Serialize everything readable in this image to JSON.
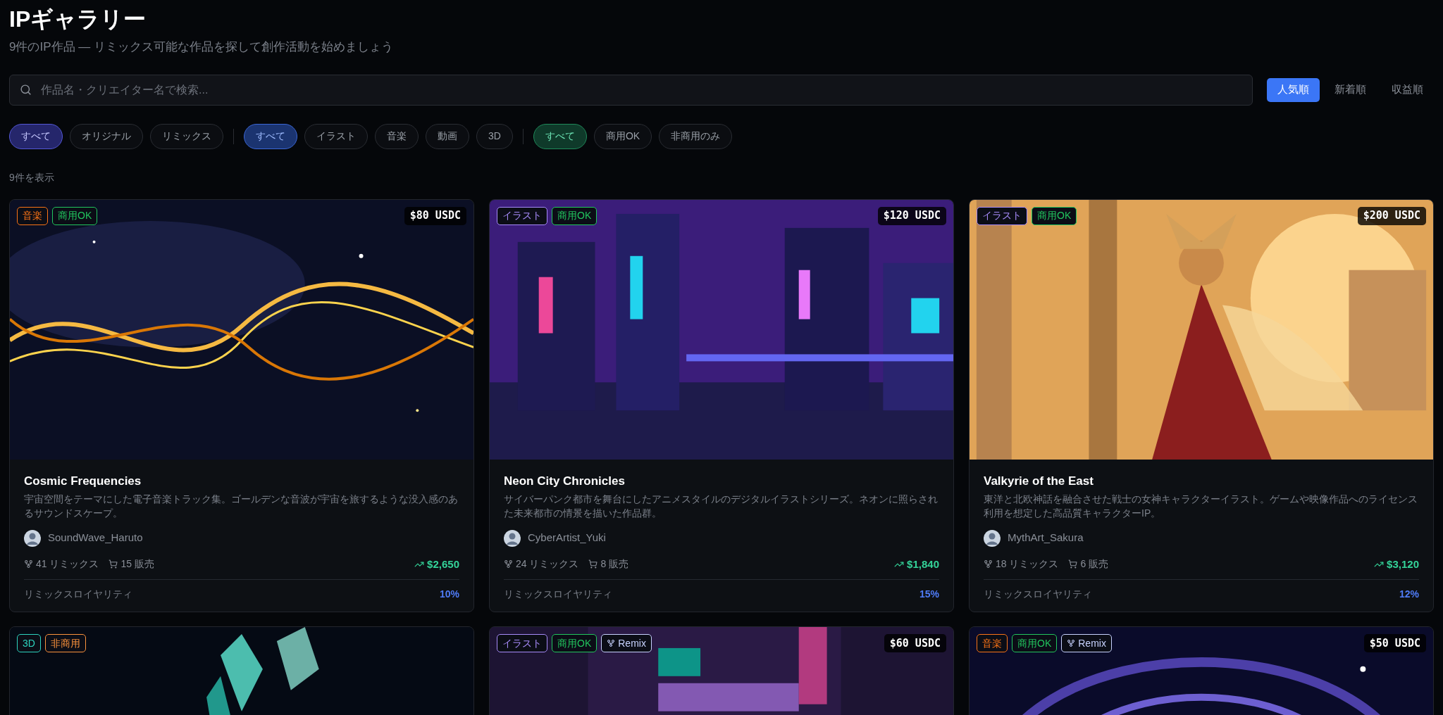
{
  "page": {
    "title": "IPギャラリー",
    "subtitle": "9件のIP作品 — リミックス可能な作品を探して創作活動を始めましょう"
  },
  "search": {
    "placeholder": "作品名・クリエイター名で検索..."
  },
  "sort_tabs": [
    {
      "label": "人気順",
      "selected": true
    },
    {
      "label": "新着順",
      "selected": false
    },
    {
      "label": "収益順",
      "selected": false
    }
  ],
  "filter_groups": [
    {
      "chips": [
        {
          "label": "すべて",
          "selected": true
        },
        {
          "label": "オリジナル",
          "selected": false
        },
        {
          "label": "リミックス",
          "selected": false
        }
      ]
    },
    {
      "chips": [
        {
          "label": "すべて",
          "selected": true
        },
        {
          "label": "イラスト",
          "selected": false
        },
        {
          "label": "音楽",
          "selected": false
        },
        {
          "label": "動画",
          "selected": false
        },
        {
          "label": "3D",
          "selected": false
        }
      ]
    },
    {
      "chips": [
        {
          "label": "すべて",
          "selected": true
        },
        {
          "label": "商用OK",
          "selected": false
        },
        {
          "label": "非商用のみ",
          "selected": false
        }
      ]
    }
  ],
  "result_count": "9件を表示",
  "cards": [
    {
      "tags": [
        {
          "kind": "label",
          "label": "音楽",
          "color": "#f97316"
        },
        {
          "kind": "label",
          "label": "商用OK",
          "color": "#22c55e"
        }
      ],
      "price": "$80 USDC",
      "title": "Cosmic Frequencies",
      "description": "宇宙空間をテーマにした電子音楽トラック集。ゴールデンな音波が宇宙を旅するような没入感のあるサウンドスケープ。",
      "creator": "SoundWave_Haruto",
      "remixes": "41 リミックス",
      "sales": "15 販売",
      "revenue": "$2,650",
      "royalty_label": "リミックスロイヤリティ",
      "royalty": "10%"
    },
    {
      "tags": [
        {
          "kind": "label",
          "label": "イラスト",
          "color": "#a78bfa"
        },
        {
          "kind": "label",
          "label": "商用OK",
          "color": "#22c55e"
        }
      ],
      "price": "$120 USDC",
      "title": "Neon City Chronicles",
      "description": "サイバーパンク都市を舞台にしたアニメスタイルのデジタルイラストシリーズ。ネオンに照らされた未来都市の情景を描いた作品群。",
      "creator": "CyberArtist_Yuki",
      "remixes": "24 リミックス",
      "sales": "8 販売",
      "revenue": "$1,840",
      "royalty_label": "リミックスロイヤリティ",
      "royalty": "15%"
    },
    {
      "tags": [
        {
          "kind": "label",
          "label": "イラスト",
          "color": "#a78bfa"
        },
        {
          "kind": "label",
          "label": "商用OK",
          "color": "#22c55e"
        }
      ],
      "price": "$200 USDC",
      "title": "Valkyrie of the East",
      "description": "東洋と北欧神話を融合させた戦士の女神キャラクターイラスト。ゲームや映像作品へのライセンス利用を想定した高品質キャラクターIP。",
      "creator": "MythArt_Sakura",
      "remixes": "18 リミックス",
      "sales": "6 販売",
      "revenue": "$3,120",
      "royalty_label": "リミックスロイヤリティ",
      "royalty": "12%"
    },
    {
      "tags": [
        {
          "kind": "label",
          "label": "3D",
          "color": "#2dd4bf"
        },
        {
          "kind": "label",
          "label": "非商用",
          "color": "#fb923c"
        }
      ]
    },
    {
      "tags": [
        {
          "kind": "label",
          "label": "イラスト",
          "color": "#a78bfa"
        },
        {
          "kind": "label",
          "label": "商用OK",
          "color": "#22c55e"
        },
        {
          "kind": "remix",
          "label": "Remix",
          "color": "#c7d2fe"
        }
      ],
      "price": "$60 USDC"
    },
    {
      "tags": [
        {
          "kind": "label",
          "label": "音楽",
          "color": "#f97316"
        },
        {
          "kind": "label",
          "label": "商用OK",
          "color": "#22c55e"
        },
        {
          "kind": "remix",
          "label": "Remix",
          "color": "#c7d2fe"
        }
      ],
      "price": "$50 USDC"
    }
  ]
}
